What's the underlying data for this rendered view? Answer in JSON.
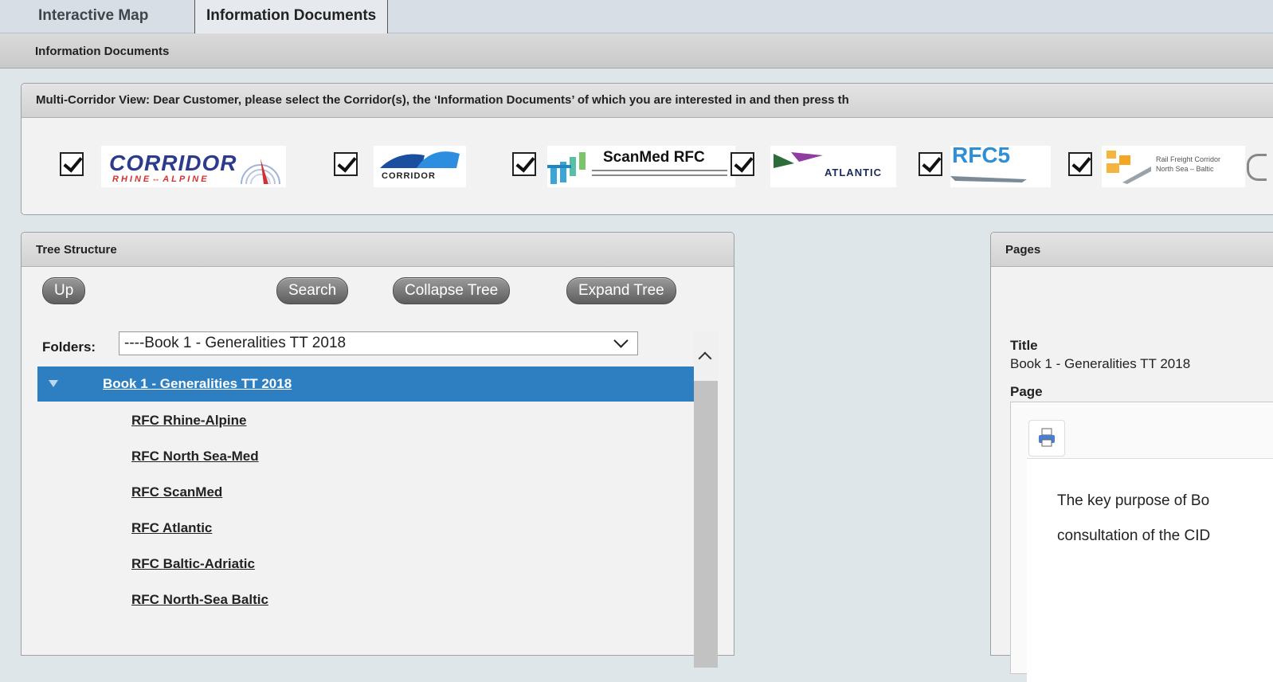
{
  "tabs": {
    "interactive_map": "Interactive Map",
    "information_documents": "Information Documents"
  },
  "subheader": "Information Documents",
  "multi_corridor": {
    "header": "Multi-Corridor View: Dear Customer, please select the Corridor(s), the ‘Information Documents’ of which you are interested in and then press th",
    "corridors": [
      {
        "checked": true,
        "logo_title": "CORRIDOR",
        "logo_sub": "RHINE⇔ALPINE"
      },
      {
        "checked": true,
        "logo_title": "CORRIDOR",
        "logo_sub": ""
      },
      {
        "checked": true,
        "logo_title": "ScanMed RFC",
        "logo_sub": ""
      },
      {
        "checked": true,
        "logo_title": "ATLANTIC",
        "logo_sub": ""
      },
      {
        "checked": true,
        "logo_title": "RFC5",
        "logo_sub": ""
      },
      {
        "checked": true,
        "logo_title": "Rail Freight Corridor",
        "logo_sub": "North Sea – Baltic"
      }
    ]
  },
  "tree": {
    "header": "Tree Structure",
    "buttons": {
      "up": "Up",
      "search": "Search",
      "collapse": "Collapse Tree",
      "expand": "Expand Tree"
    },
    "folders_label": "Folders:",
    "folders_selected": "----Book 1 - Generalities TT 2018",
    "root": "Book 1 - Generalities TT 2018",
    "children": [
      "RFC Rhine-Alpine",
      "RFC North Sea-Med",
      "RFC ScanMed",
      "RFC Atlantic",
      "RFC Baltic-Adriatic",
      "RFC North-Sea Baltic"
    ]
  },
  "pages": {
    "header": "Pages",
    "title_label": "Title",
    "title_value": "Book 1 - Generalities TT 2018",
    "page_label": "Page",
    "body_line1": "The key purpose of Bo",
    "body_line2": "consultation of the CID"
  },
  "colors": {
    "selected_node": "#2e7fc1",
    "button": "#6b6b6b"
  },
  "icons": [
    "checkbox-checked-icon",
    "print-icon",
    "chevron-down-icon",
    "scroll-up-icon",
    "tree-expanded-icon"
  ]
}
